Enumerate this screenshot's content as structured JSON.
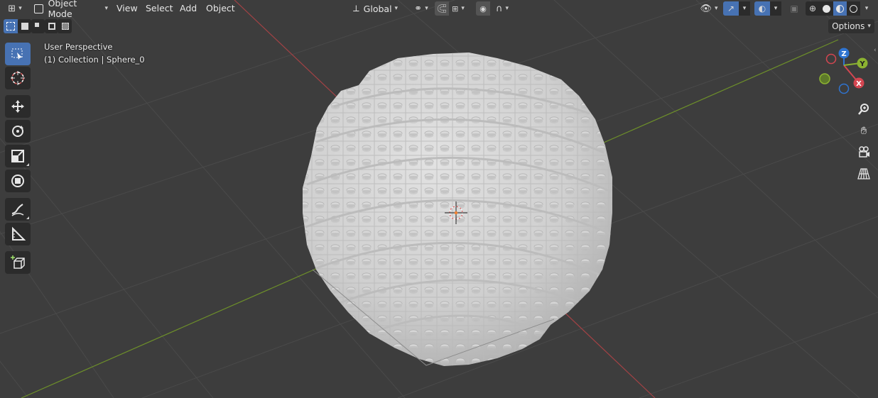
{
  "header": {
    "editor_type_icon": "editor-type-icon",
    "mode": {
      "label": "Object Mode",
      "icon": "object-mode-icon"
    },
    "menus": [
      "View",
      "Select",
      "Add",
      "Object"
    ],
    "transform_orientation": {
      "label": "Global",
      "icon": "transform-orientation-icon"
    },
    "pivot_icon": "pivot-point-icon",
    "snap_icon": "snap-icon",
    "proportional_icon": "proportional-editing-icon",
    "falloff_icon": "falloff-curve-icon",
    "visibility_icon": "visibility-eye-icon",
    "gizmo_icon": "gizmo-toggle-icon",
    "overlay_icon": "overlay-toggle-icon",
    "xray_icon": "xray-toggle-icon",
    "shading_modes": [
      "wireframe",
      "solid",
      "material-preview",
      "rendered"
    ],
    "active_shading": "material-preview"
  },
  "selection_modes": [
    "select-new",
    "select-extend",
    "select-subtract",
    "select-intersect",
    "select-invert"
  ],
  "options_label": "Options",
  "overlay": {
    "view_name": "User Perspective",
    "collection_info": "(1) Collection | Sphere_0"
  },
  "tools": [
    {
      "name": "select-box",
      "active": true
    },
    {
      "name": "cursor",
      "active": false
    },
    {
      "name": "move",
      "active": false
    },
    {
      "name": "rotate",
      "active": false
    },
    {
      "name": "scale",
      "active": false
    },
    {
      "name": "transform",
      "active": false
    },
    {
      "name": "annotate",
      "active": false
    },
    {
      "name": "measure",
      "active": false
    },
    {
      "name": "add-cube",
      "active": false
    }
  ],
  "gizmo": {
    "axes": {
      "x": "X",
      "y": "Y",
      "z": "Z"
    },
    "colors": {
      "x": "#d44651",
      "y": "#8cb331",
      "z": "#2f74d1"
    }
  },
  "navigation": [
    "zoom",
    "pan",
    "camera-view",
    "orthographic-toggle"
  ],
  "colors": {
    "viewport_bg": "#3d3d3d",
    "grid": "#4a4a4a",
    "x_axis": "#a34245",
    "y_axis": "#6d8f2a",
    "active_tool": "#4772b3",
    "brick": "#cfcfcf"
  }
}
